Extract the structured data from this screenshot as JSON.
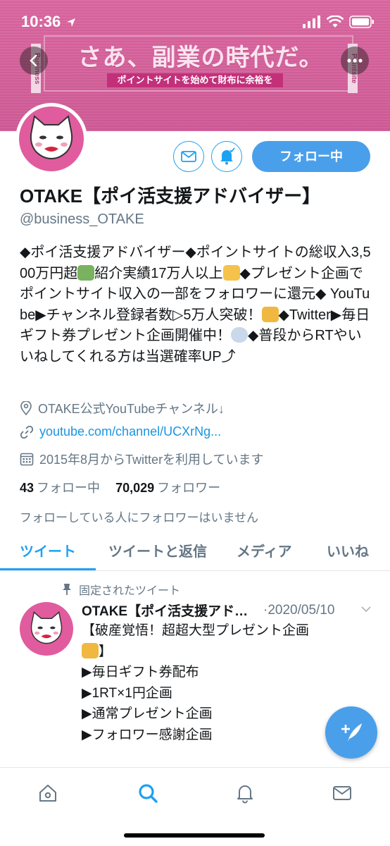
{
  "status": {
    "time": "10:36"
  },
  "banner": {
    "headline": "さあ、副業の時代だ。",
    "subline": "ポイントサイトを始めて財布に余裕を",
    "vertical_left": "Business",
    "vertical_right": "Pointsite"
  },
  "profile": {
    "name": "OTAKE【ポイ活支援アドバイザー】",
    "handle": "@business_OTAKE",
    "follow_label": "フォロー中",
    "bio_parts": [
      "◆ポイ活支援アドバイザー◆ポイントサイトの総収入3,500万円超",
      "紹介実績17万人以上",
      "◆プレゼント企画でポイントサイト収入の一部をフォロワーに還元◆ YouTube▶チャンネル登録者数▷5万人突破！",
      "◆Twitter▶毎日ギフト券プレゼント企画開催中！",
      "◆普段からRTやいいねしてくれる方は当選確率UP⤴"
    ],
    "location": "OTAKE公式YouTubeチャンネル↓",
    "url": "youtube.com/channel/UCXrNg...",
    "joined": "2015年8月からTwitterを利用しています",
    "following_count": "43",
    "following_label": "フォロー中",
    "followers_count": "70,029",
    "followers_label": "フォロワー",
    "mutual_note": "フォローしている人にフォロワーはいません"
  },
  "tabs": [
    {
      "label": "ツイート"
    },
    {
      "label": "ツイートと返信"
    },
    {
      "label": "メディア"
    },
    {
      "label": "いいね"
    }
  ],
  "tweet": {
    "pinned_label": "固定されたツイート",
    "author": "OTAKE【ポイ活支援アドバイザー】",
    "date": "·2020/05/10",
    "body_line1": "【破産覚悟！超超大型プレゼント企画",
    "body_line2": "】",
    "body_rest": "\n▶毎日ギフト券配布\n▶1RT×1円企画\n▶通常プレゼント企画\n▶フォロワー感謝企画"
  },
  "colors": {
    "accent": "#1da1f2",
    "banner": "#d9669f",
    "avatar_bg": "#e05c9e"
  },
  "icons": [
    "back-icon",
    "more-icon",
    "mail-icon",
    "bell-icon",
    "location-icon",
    "link-icon",
    "calendar-icon",
    "pin-icon",
    "chevron-down-icon",
    "compose-icon",
    "home-icon",
    "search-icon",
    "notifications-icon",
    "messages-icon"
  ]
}
